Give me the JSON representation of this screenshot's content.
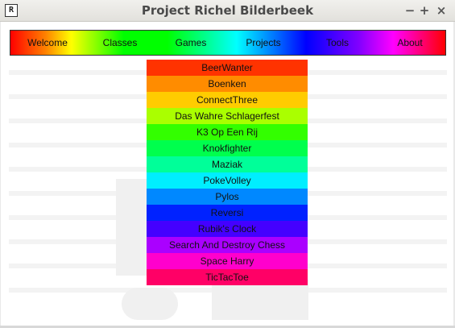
{
  "window": {
    "title": "Project Richel Bilderbeek",
    "icon_text": "R",
    "minimize": "−",
    "maximize": "+",
    "close": "×"
  },
  "menu": {
    "items": [
      {
        "label": "Welcome"
      },
      {
        "label": "Classes"
      },
      {
        "label": "Games"
      },
      {
        "label": "Projects"
      },
      {
        "label": "Tools"
      },
      {
        "label": "About"
      }
    ]
  },
  "games_dropdown": {
    "items": [
      {
        "label": "BeerWanter",
        "color": "#ff3300"
      },
      {
        "label": "Boenken",
        "color": "#ff8c00"
      },
      {
        "label": "ConnectThree",
        "color": "#ffcc00"
      },
      {
        "label": "Das Wahre Schlagerfest",
        "color": "#aaff00"
      },
      {
        "label": "K3 Op Een Rij",
        "color": "#33ff00"
      },
      {
        "label": "Knokfighter",
        "color": "#00ff4d"
      },
      {
        "label": "Maziak",
        "color": "#00ff99"
      },
      {
        "label": "PokeVolley",
        "color": "#00eeff"
      },
      {
        "label": "Pylos",
        "color": "#0088ff"
      },
      {
        "label": "Reversi",
        "color": "#0022ff"
      },
      {
        "label": "Rubik's Clock",
        "color": "#4400ff"
      },
      {
        "label": "Search And Destroy Chess",
        "color": "#aa00ff"
      },
      {
        "label": "Space Harry",
        "color": "#ff00cc"
      },
      {
        "label": "TicTacToe",
        "color": "#ff0066"
      }
    ]
  }
}
